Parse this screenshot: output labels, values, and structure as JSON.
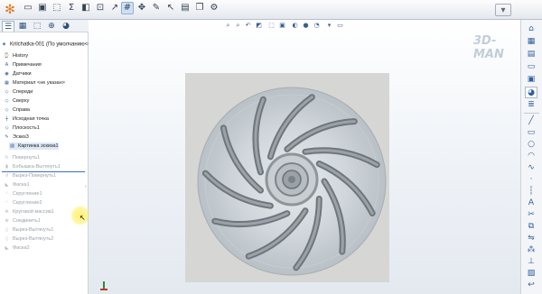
{
  "watermark": "3D-MAN",
  "toolbar": {
    "icons": [
      "solidworks-logo",
      "open-icon",
      "save-icon",
      "select-icon",
      "sigma-icon",
      "rebuild-icon",
      "options-icon",
      "arrow-icon",
      "grid-icon",
      "move-icon",
      "pencil-icon",
      "cursor-icon",
      "box-icon",
      "copy-icon",
      "settings-icon",
      "window-icon"
    ]
  },
  "left_panel": {
    "tabs": [
      "feature-manager-tab",
      "property-manager-tab",
      "config-tab",
      "dimxpert-tab",
      "display-tab"
    ],
    "root": "Krilchatka-001 (По умолчанию<<П",
    "items": [
      {
        "label": "History",
        "icon": "history-icon",
        "dim": false
      },
      {
        "label": "Примечания",
        "icon": "annotation-icon",
        "dim": false
      },
      {
        "label": "Датчики",
        "icon": "sensor-icon",
        "dim": false
      },
      {
        "label": "Материал <не указан>",
        "icon": "material-icon",
        "dim": false
      },
      {
        "label": "Спереди",
        "icon": "plane-icon",
        "dim": false
      },
      {
        "label": "Сверху",
        "icon": "plane-icon",
        "dim": false
      },
      {
        "label": "Справа",
        "icon": "plane-icon",
        "dim": false
      },
      {
        "label": "Исходная точка",
        "icon": "origin-icon",
        "dim": false
      },
      {
        "label": "Плоскость1",
        "icon": "plane-icon",
        "dim": false
      },
      {
        "label": "Эскиз3",
        "icon": "sketch-icon",
        "dim": false
      },
      {
        "label": "Картинка эскиза1",
        "icon": "picture-icon",
        "dim": false
      },
      {
        "label": "Повернуть1",
        "icon": "revolve-icon",
        "dim": true
      },
      {
        "label": "Бобышка-Вытянуть1",
        "icon": "extrude-icon",
        "dim": true
      },
      {
        "label": "Вырез-Повернуть1",
        "icon": "cut-revolve-icon",
        "dim": true
      },
      {
        "label": "Фаска1",
        "icon": "chamfer-icon",
        "dim": true
      },
      {
        "label": "Скругление1",
        "icon": "fillet-icon",
        "dim": true
      },
      {
        "label": "Скругление2",
        "icon": "fillet-icon",
        "dim": true
      },
      {
        "label": "Круговой массив1",
        "icon": "pattern-icon",
        "dim": true
      },
      {
        "label": "Соединить1",
        "icon": "combine-icon",
        "dim": true
      },
      {
        "label": "Вырез-Вытянуть1",
        "icon": "cut-extrude-icon",
        "dim": true
      },
      {
        "label": "Вырез-Вытянуть2",
        "icon": "cut-extrude-icon",
        "dim": true
      },
      {
        "label": "Фаска2",
        "icon": "chamfer-icon",
        "dim": true
      }
    ]
  },
  "viewport": {
    "hud_icons": [
      "zoom-fit-icon",
      "zoom-area-icon",
      "previous-view-icon",
      "section-view-icon",
      "view-orientation-icon",
      "display-style-icon",
      "hide-show-icon",
      "edit-appearance-icon",
      "scene-icon",
      "view-settings-icon",
      "monitor-icon"
    ],
    "image_subject": "impeller"
  },
  "right_panel": {
    "tools": [
      "home-icon",
      "resources-icon",
      "design-library-icon",
      "file-explorer-icon",
      "view-palette-icon",
      "appearances-icon",
      "custom-properties-icon",
      "line-icon",
      "rectangle-icon",
      "circle-icon",
      "arc-icon",
      "spline-icon",
      "point-icon",
      "centerline-icon",
      "text-icon",
      "trim-icon",
      "offset-icon",
      "mirror-icon",
      "pattern-icon",
      "relations-icon",
      "sketch-picture-icon",
      "exit-sketch-icon"
    ]
  }
}
